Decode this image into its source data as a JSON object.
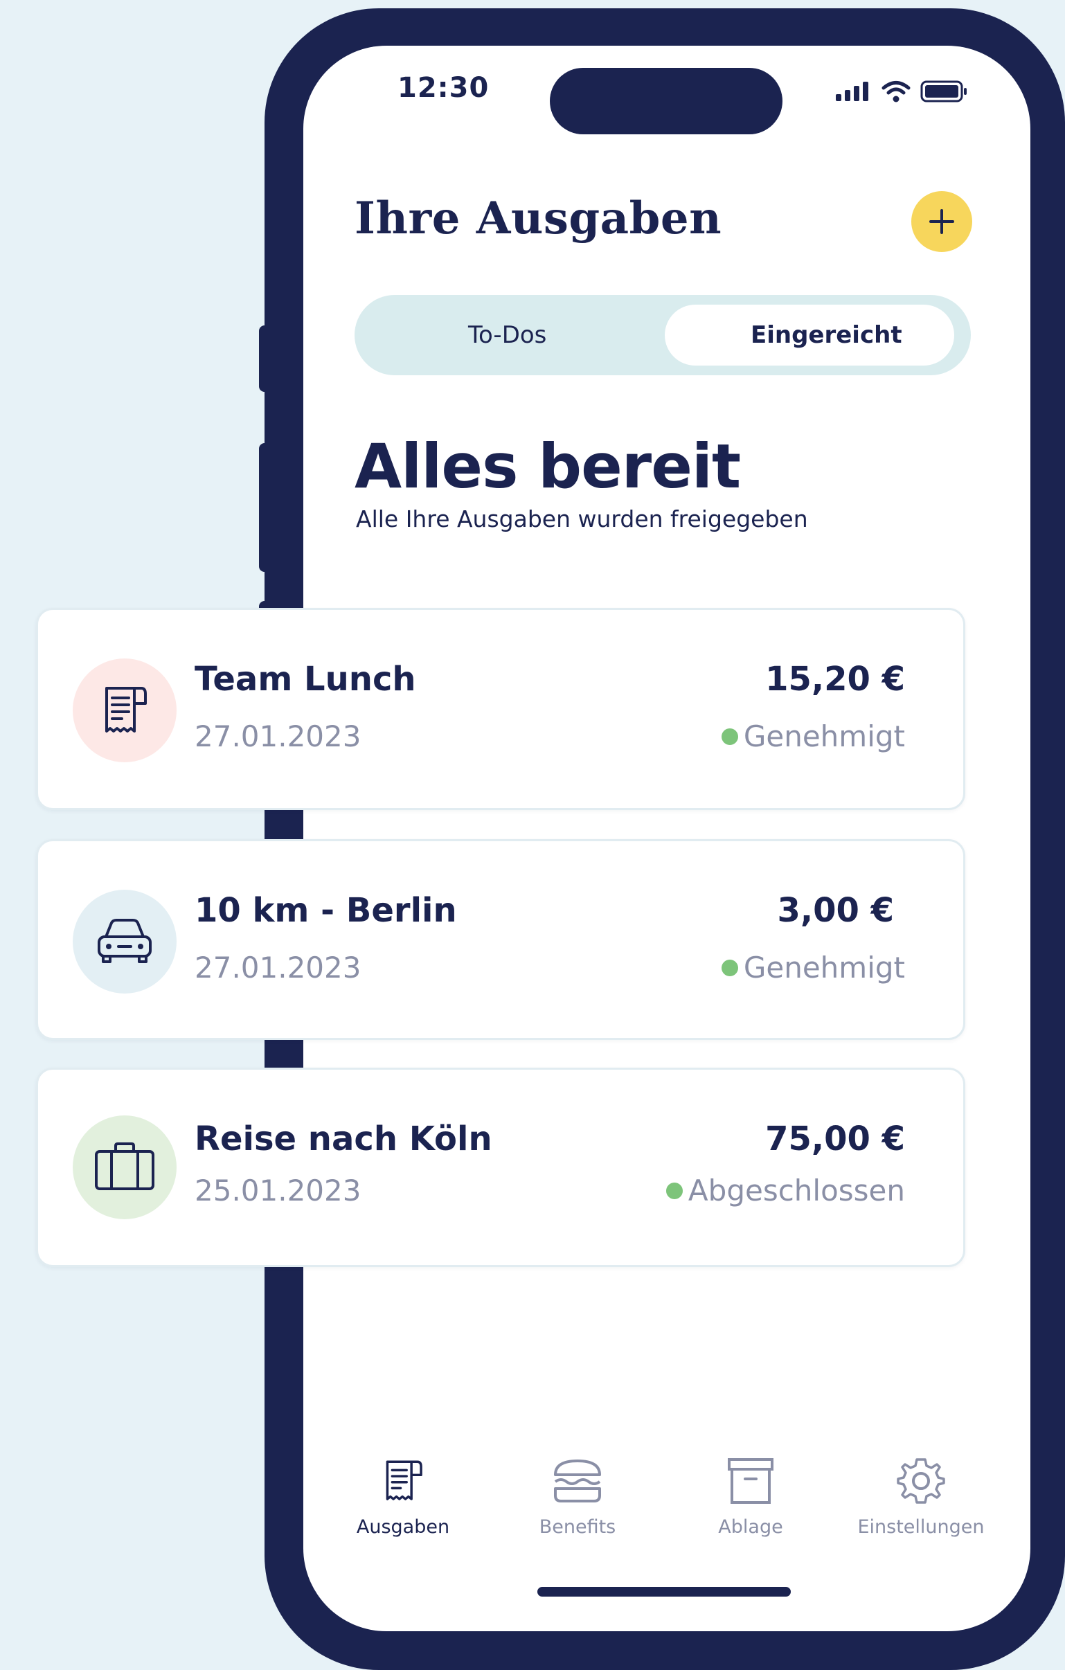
{
  "colors": {
    "background": "#e7f2f7",
    "phone_frame": "#1b2350",
    "accent_yellow": "#f7d65c",
    "segment_bg": "#d9ecee",
    "status_green": "#7dc47a",
    "muted_text": "#8a8fa6"
  },
  "status_bar": {
    "time": "12:30",
    "icons": [
      "signal-icon",
      "wifi-icon",
      "battery-icon"
    ]
  },
  "header": {
    "title": "Ihre Ausgaben",
    "add_icon": "plus-icon"
  },
  "tabs": [
    {
      "label": "To-Dos",
      "selected": false
    },
    {
      "label": "Eingereicht",
      "selected": true
    }
  ],
  "hero": {
    "title": "Alles bereit",
    "subtitle": "Alle Ihre Ausgaben wurden freigegeben"
  },
  "expenses": [
    {
      "icon": "receipt-icon",
      "name": "Team Lunch",
      "date": "27.01.2023",
      "amount": "15,20 €",
      "status": "Genehmigt"
    },
    {
      "icon": "car-icon",
      "name": "10 km - Berlin",
      "date": "27.01.2023",
      "amount": "3,00 €",
      "status": "Genehmigt"
    },
    {
      "icon": "suitcase-icon",
      "name": "Reise nach Köln",
      "date": "25.01.2023",
      "amount": "75,00 €",
      "status": "Abgeschlossen"
    }
  ],
  "bottom_nav": [
    {
      "label": "Ausgaben",
      "icon": "receipt-icon",
      "active": true
    },
    {
      "label": "Benefits",
      "icon": "burger-icon",
      "active": false
    },
    {
      "label": "Ablage",
      "icon": "archive-box-icon",
      "active": false
    },
    {
      "label": "Einstellungen",
      "icon": "gear-icon",
      "active": false
    }
  ]
}
